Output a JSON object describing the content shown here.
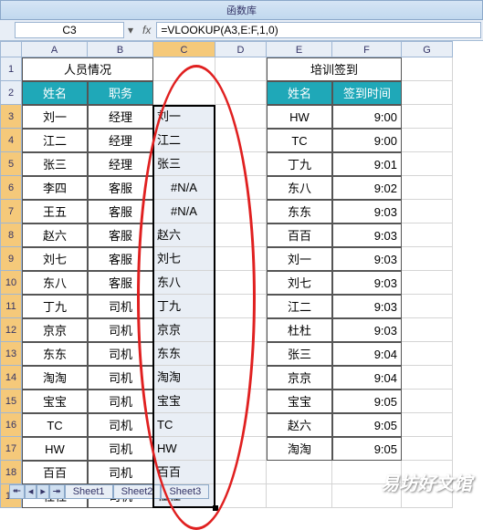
{
  "ribbon": {
    "group": "函数库"
  },
  "namebox": {
    "value": "C3"
  },
  "formula_bar": {
    "fx": "fx",
    "formula": "=VLOOKUP(A3,E:F,1,0)"
  },
  "columns": [
    "A",
    "B",
    "C",
    "D",
    "E",
    "F",
    "G"
  ],
  "rows_visible": 19,
  "titles": {
    "left": "人员情况",
    "right": "培训签到"
  },
  "headers": {
    "name": "姓名",
    "role": "职务",
    "signin_name": "姓名",
    "signin_time": "签到时间"
  },
  "table_left": [
    {
      "name": "刘一",
      "role": "经理",
      "c": "刘一"
    },
    {
      "name": "江二",
      "role": "经理",
      "c": "江二"
    },
    {
      "name": "张三",
      "role": "经理",
      "c": "张三"
    },
    {
      "name": "李四",
      "role": "客服",
      "c": "#N/A"
    },
    {
      "name": "王五",
      "role": "客服",
      "c": "#N/A"
    },
    {
      "name": "赵六",
      "role": "客服",
      "c": "赵六"
    },
    {
      "name": "刘七",
      "role": "客服",
      "c": "刘七"
    },
    {
      "name": "东八",
      "role": "客服",
      "c": "东八"
    },
    {
      "name": "丁九",
      "role": "司机",
      "c": "丁九"
    },
    {
      "name": "京京",
      "role": "司机",
      "c": "京京"
    },
    {
      "name": "东东",
      "role": "司机",
      "c": "东东"
    },
    {
      "name": "淘淘",
      "role": "司机",
      "c": "淘淘"
    },
    {
      "name": "宝宝",
      "role": "司机",
      "c": "宝宝"
    },
    {
      "name": "TC",
      "role": "司机",
      "c": "TC"
    },
    {
      "name": "HW",
      "role": "司机",
      "c": "HW"
    },
    {
      "name": "百百",
      "role": "司机",
      "c": "百百"
    },
    {
      "name": "杜杜",
      "role": "司机",
      "c": "杜杜"
    }
  ],
  "table_right": [
    {
      "name": "HW",
      "time": "9:00"
    },
    {
      "name": "TC",
      "time": "9:00"
    },
    {
      "name": "丁九",
      "time": "9:01"
    },
    {
      "name": "东八",
      "time": "9:02"
    },
    {
      "name": "东东",
      "time": "9:03"
    },
    {
      "name": "百百",
      "time": "9:03"
    },
    {
      "name": "刘一",
      "time": "9:03"
    },
    {
      "name": "刘七",
      "time": "9:03"
    },
    {
      "name": "江二",
      "time": "9:03"
    },
    {
      "name": "杜杜",
      "time": "9:03"
    },
    {
      "name": "张三",
      "time": "9:04"
    },
    {
      "name": "京京",
      "time": "9:04"
    },
    {
      "name": "宝宝",
      "time": "9:05"
    },
    {
      "name": "赵六",
      "time": "9:05"
    },
    {
      "name": "淘淘",
      "time": "9:05"
    }
  ],
  "sheets": [
    "Sheet1",
    "Sheet2",
    "Sheet3"
  ],
  "watermark": "易坊好文馆"
}
